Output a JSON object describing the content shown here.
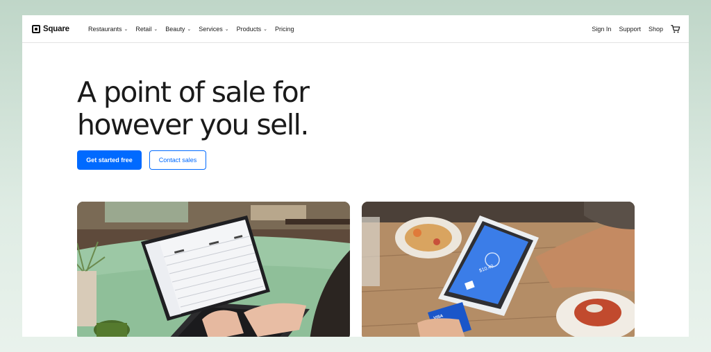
{
  "brand": {
    "name": "Square"
  },
  "nav": {
    "items": [
      {
        "label": "Restaurants"
      },
      {
        "label": "Retail"
      },
      {
        "label": "Beauty"
      },
      {
        "label": "Services"
      },
      {
        "label": "Products"
      },
      {
        "label": "Pricing"
      }
    ],
    "right": {
      "sign_in": "Sign In",
      "support": "Support",
      "shop": "Shop"
    }
  },
  "hero": {
    "headline_line1": "A point of sale for",
    "headline_line2": "however you sell.",
    "primary_cta": "Get started free",
    "secondary_cta": "Contact sales"
  },
  "images": {
    "left": {
      "subject": "laptop-dashboard-photo"
    },
    "right": {
      "subject": "card-terminal-payment-photo"
    },
    "terminal_screen": {
      "amount": "$10.40",
      "note": "Tap, insert or swipe"
    },
    "card_brand": "VISA"
  },
  "colors": {
    "accent": "#006aff",
    "text": "#1a1a1a",
    "backdrop": "#cfe1d5"
  }
}
